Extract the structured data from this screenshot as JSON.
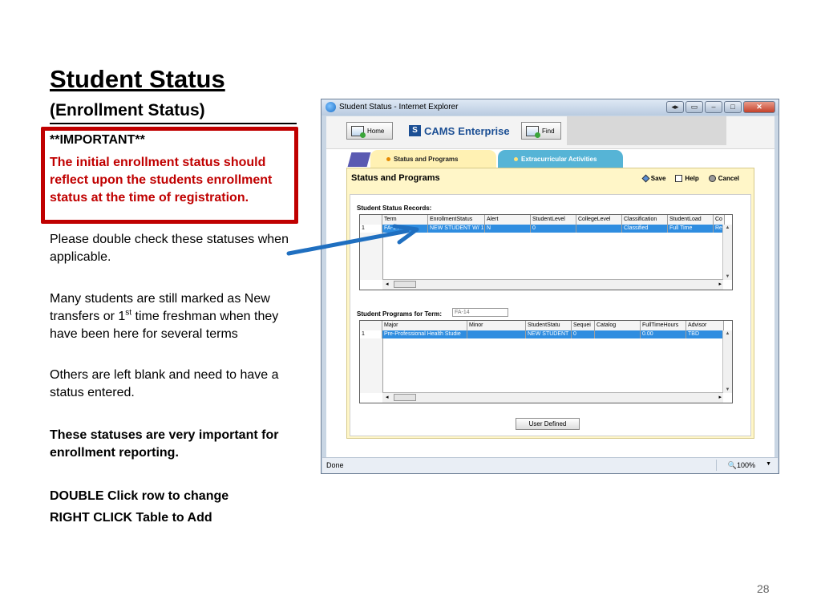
{
  "slide": {
    "title": "Student Status",
    "subtitle": "(Enrollment Status)",
    "callout_heading": "**IMPORTANT**",
    "callout_body": "The initial enrollment status should reflect upon the students enrollment status at the time of registration.",
    "para1": "Please double check these statuses when applicable.",
    "para2_a": "Many students are still marked as New transfers  or  1",
    "para2_sup": "st",
    "para2_b": " time freshman when they have been here for several terms",
    "para3": "Others are left blank and need to have a status entered.",
    "para4": "These statuses are very important for enrollment reporting.",
    "para5_line1": "DOUBLE Click row to change",
    "para5_line2": "RIGHT CLICK Table to Add",
    "page_number": "28"
  },
  "window": {
    "title": "Student Status - Internet Explorer",
    "status_text": "Done",
    "zoom": "100%"
  },
  "toolbar": {
    "home_label": "Home",
    "brand_name": "CAMS",
    "brand_suffix": "Enterprise",
    "find_label": "Find"
  },
  "tabs": [
    {
      "label": "Status and Programs"
    },
    {
      "label": "Extracurricular Activities"
    }
  ],
  "panel": {
    "title": "Status and Programs",
    "save_label": "Save",
    "help_label": "Help",
    "cancel_label": "Cancel",
    "records_label": "Student Status Records:",
    "programs_label": "Student Programs for Term:",
    "programs_term": "FA-14",
    "user_defined_label": "User Defined"
  },
  "status_grid": {
    "columns": [
      "Term",
      "EnrollmentStatus",
      "Alert",
      "StudentLevel",
      "CollegeLevel",
      "Classification",
      "StudentLoad",
      "Co"
    ],
    "rows": [
      {
        "n": "1",
        "cells": [
          "FA-14",
          "NEW STUDENT W/ 1",
          "N",
          "0",
          "",
          "Classified",
          "Full Time",
          "Re"
        ]
      }
    ]
  },
  "program_grid": {
    "columns": [
      "Major",
      "Minor",
      "StudentStatu",
      "Sequei",
      "Catalog",
      "FullTimeHours",
      "Advisor"
    ],
    "rows": [
      {
        "n": "1",
        "cells": [
          "Pre-Professional Health Studie",
          "",
          "NEW STUDENT",
          "0",
          "",
          "0.00",
          "TBD"
        ]
      }
    ]
  },
  "colors": {
    "callout_border": "#c00000",
    "callout_text": "#c00000",
    "arrow": "#1f6fc0",
    "selected_row": "#2f8de0",
    "panel_bg": "#fff6c8",
    "active_tab": "#fff1b3",
    "inactive_tab": "#56b4d6"
  },
  "icons": [
    "ie-logo-icon",
    "home-icon",
    "find-icon",
    "save-icon",
    "help-icon",
    "cancel-icon"
  ]
}
